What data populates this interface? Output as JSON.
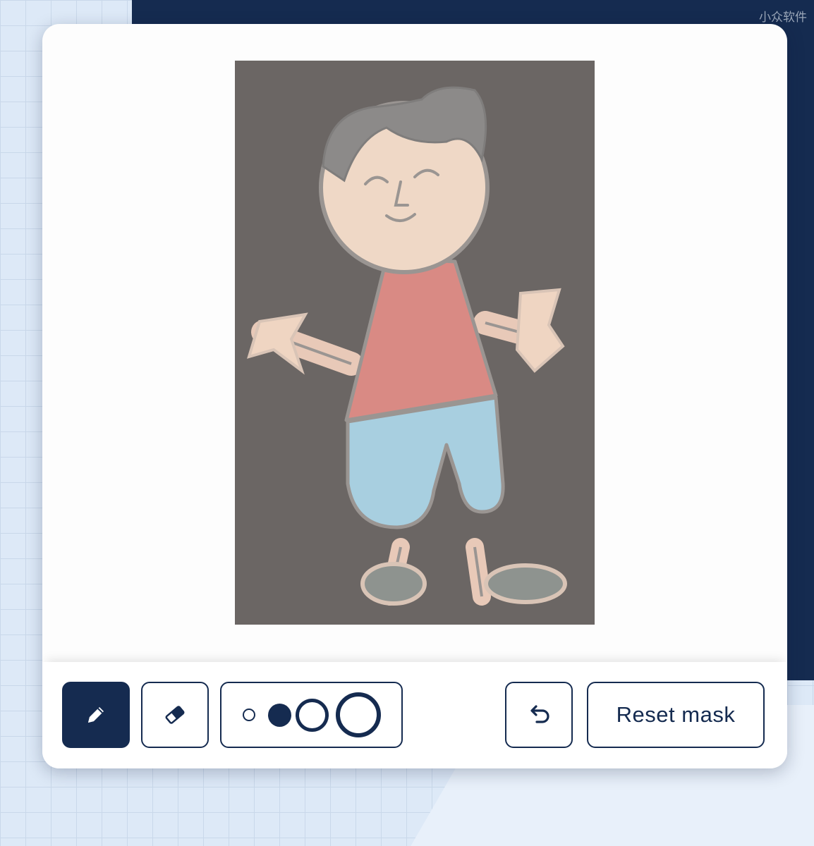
{
  "watermark": "小众软件",
  "toolbar": {
    "pencil_icon": "pencil-icon",
    "eraser_icon": "eraser-icon",
    "brush_sizes": [
      "extra-small",
      "small",
      "medium",
      "large"
    ],
    "selected_brush_size": "small",
    "undo_icon": "undo-icon",
    "reset_label": "Reset mask"
  },
  "colors": {
    "navy": "#152b50",
    "background": "#dde9f7",
    "drawing_background": "#6b6664"
  }
}
